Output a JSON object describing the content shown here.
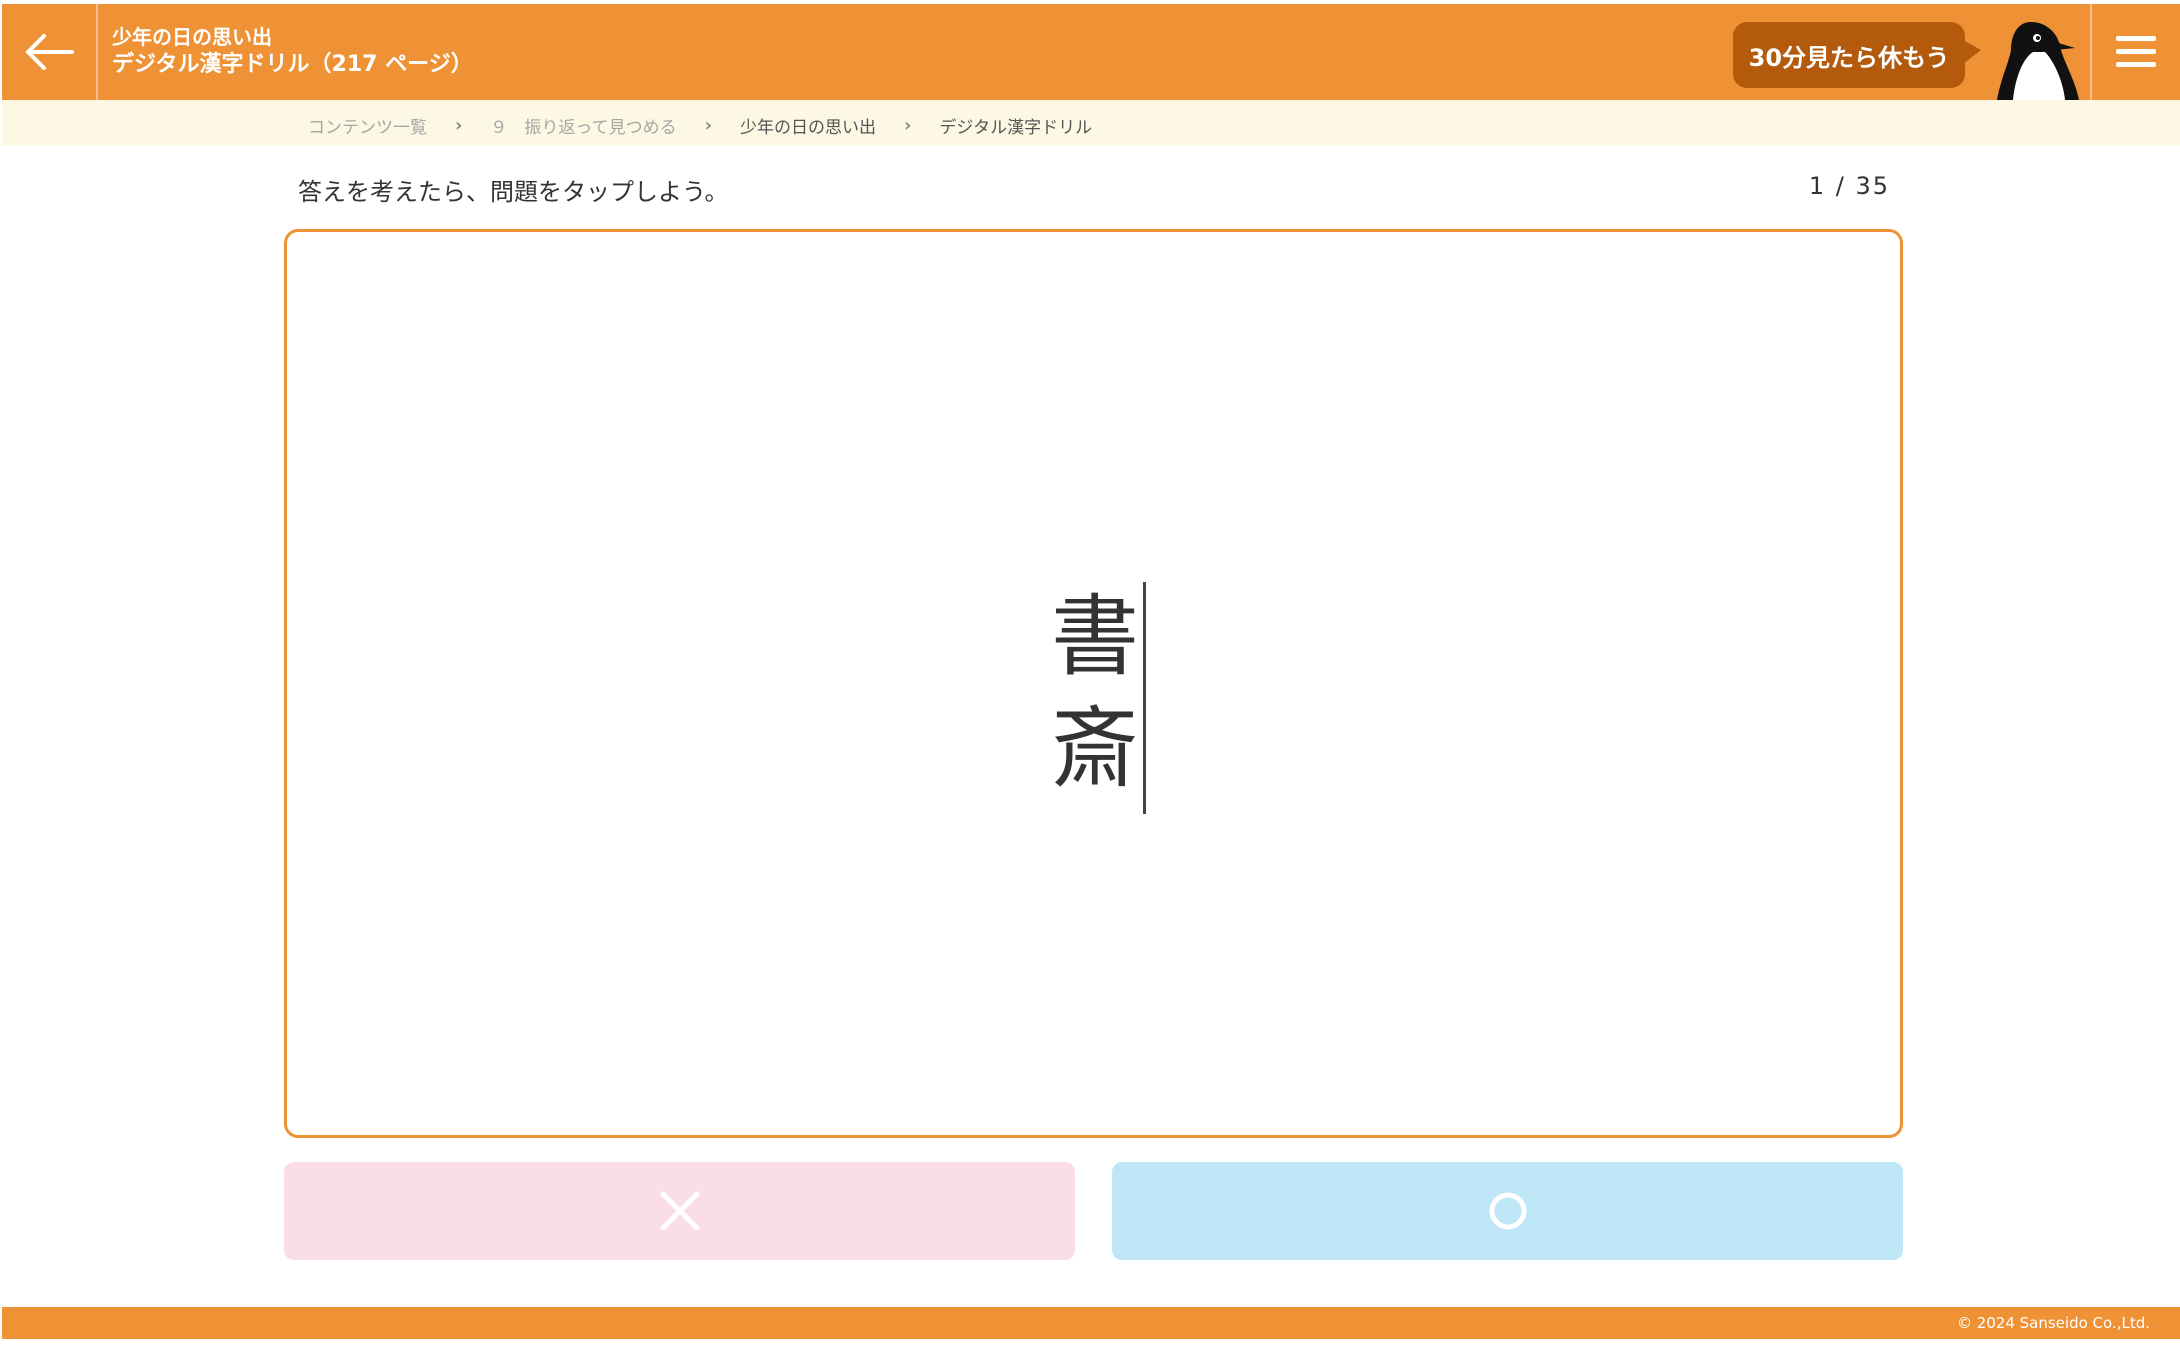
{
  "header": {
    "back_icon": "arrow-left-icon",
    "subtitle": "少年の日の思い出",
    "title": "デジタル漢字ドリル（217 ページ）",
    "break_reminder": "30分見たら休もう",
    "mascot": "penguin-icon",
    "menu_icon": "hamburger-menu-icon"
  },
  "breadcrumb": {
    "items": [
      "コンテンツ一覧",
      "９　振り返って見つめる",
      "少年の日の思い出",
      "デジタル漢字ドリル"
    ]
  },
  "quiz": {
    "instruction": "答えを考えたら、問題をタップしよう。",
    "counter": "1 / 35",
    "word_chars": [
      "書",
      "斎"
    ]
  },
  "answers": {
    "wrong_icon": "cross-icon",
    "right_icon": "circle-icon"
  },
  "footer": {
    "copyright": "© 2024 Sanseido Co.,Ltd."
  },
  "colors": {
    "brand_orange": "#ef9236",
    "bubble_brown": "#b35a0d",
    "breadcrumb_bg": "#fdf8e4",
    "wrong_bg": "#fadde6",
    "right_bg": "#bfe6f6"
  }
}
